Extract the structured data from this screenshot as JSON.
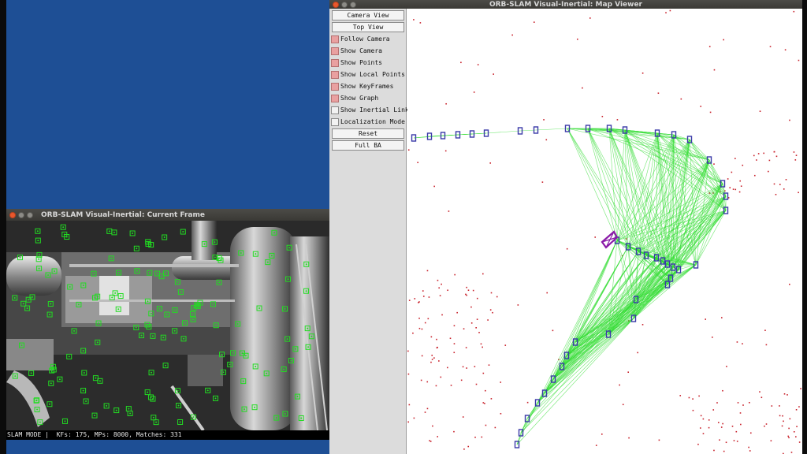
{
  "current_frame_window": {
    "title": "ORB-SLAM Visual-Inertial: Current Frame",
    "status_text": "SLAM MODE |  KFs: 175, MPs: 8000, Matches: 331"
  },
  "map_viewer_window": {
    "title": "ORB-SLAM Visual-Inertial: Map Viewer",
    "buttons": {
      "camera_view": "Camera View",
      "top_view": "Top View",
      "reset": "Reset",
      "full_ba": "Full BA"
    },
    "checkboxes": [
      {
        "label": "Follow Camera",
        "checked": true
      },
      {
        "label": "Show Camera",
        "checked": true
      },
      {
        "label": "Show Points",
        "checked": true
      },
      {
        "label": "Show Local Points",
        "checked": true
      },
      {
        "label": "Show KeyFrames",
        "checked": true
      },
      {
        "label": "Show Graph",
        "checked": true
      },
      {
        "label": "Show Inertial Links",
        "checked": false
      },
      {
        "label": "Localization Mode",
        "checked": false
      }
    ]
  },
  "colors": {
    "desktop": "#1e4f95",
    "checkbox_on": "#e9a0a0",
    "feature_marker": "#22dd22",
    "graph_edge": "#33dd33",
    "keyframe": "#3a3aa8",
    "current_camera": "#8a1aa8",
    "map_point": "#c8202a"
  },
  "icons": [
    "window-close-icon",
    "window-minimize-icon",
    "window-maximize-icon"
  ]
}
